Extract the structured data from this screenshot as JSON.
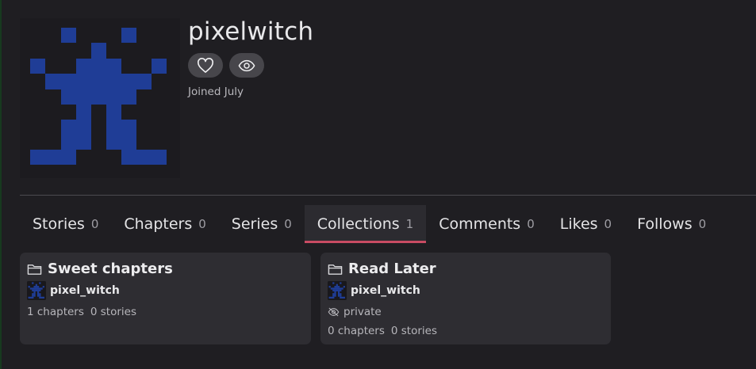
{
  "profile": {
    "username": "pixelwitch",
    "joined": "Joined July",
    "avatar_color": "#1f3d96"
  },
  "actions": {
    "like_icon": "heart-icon",
    "watch_icon": "eye-icon"
  },
  "tabs": [
    {
      "label": "Stories",
      "count": "0"
    },
    {
      "label": "Chapters",
      "count": "0"
    },
    {
      "label": "Series",
      "count": "0"
    },
    {
      "label": "Collections",
      "count": "1",
      "active": true
    },
    {
      "label": "Comments",
      "count": "0"
    },
    {
      "label": "Likes",
      "count": "0"
    },
    {
      "label": "Follows",
      "count": "0"
    }
  ],
  "collections": [
    {
      "title": "Sweet chapters",
      "owner": "pixel_witch",
      "chapters": "1 chapters",
      "stories": "0 stories"
    },
    {
      "title": "Read Later",
      "owner": "pixel_witch",
      "privacy": "private",
      "chapters": "0 chapters",
      "stories": "0 stories"
    }
  ],
  "colors": {
    "background": "#1f1e22",
    "card": "#2e2d32",
    "active_tab_underline": "#c94b63",
    "button": "#47464b"
  }
}
